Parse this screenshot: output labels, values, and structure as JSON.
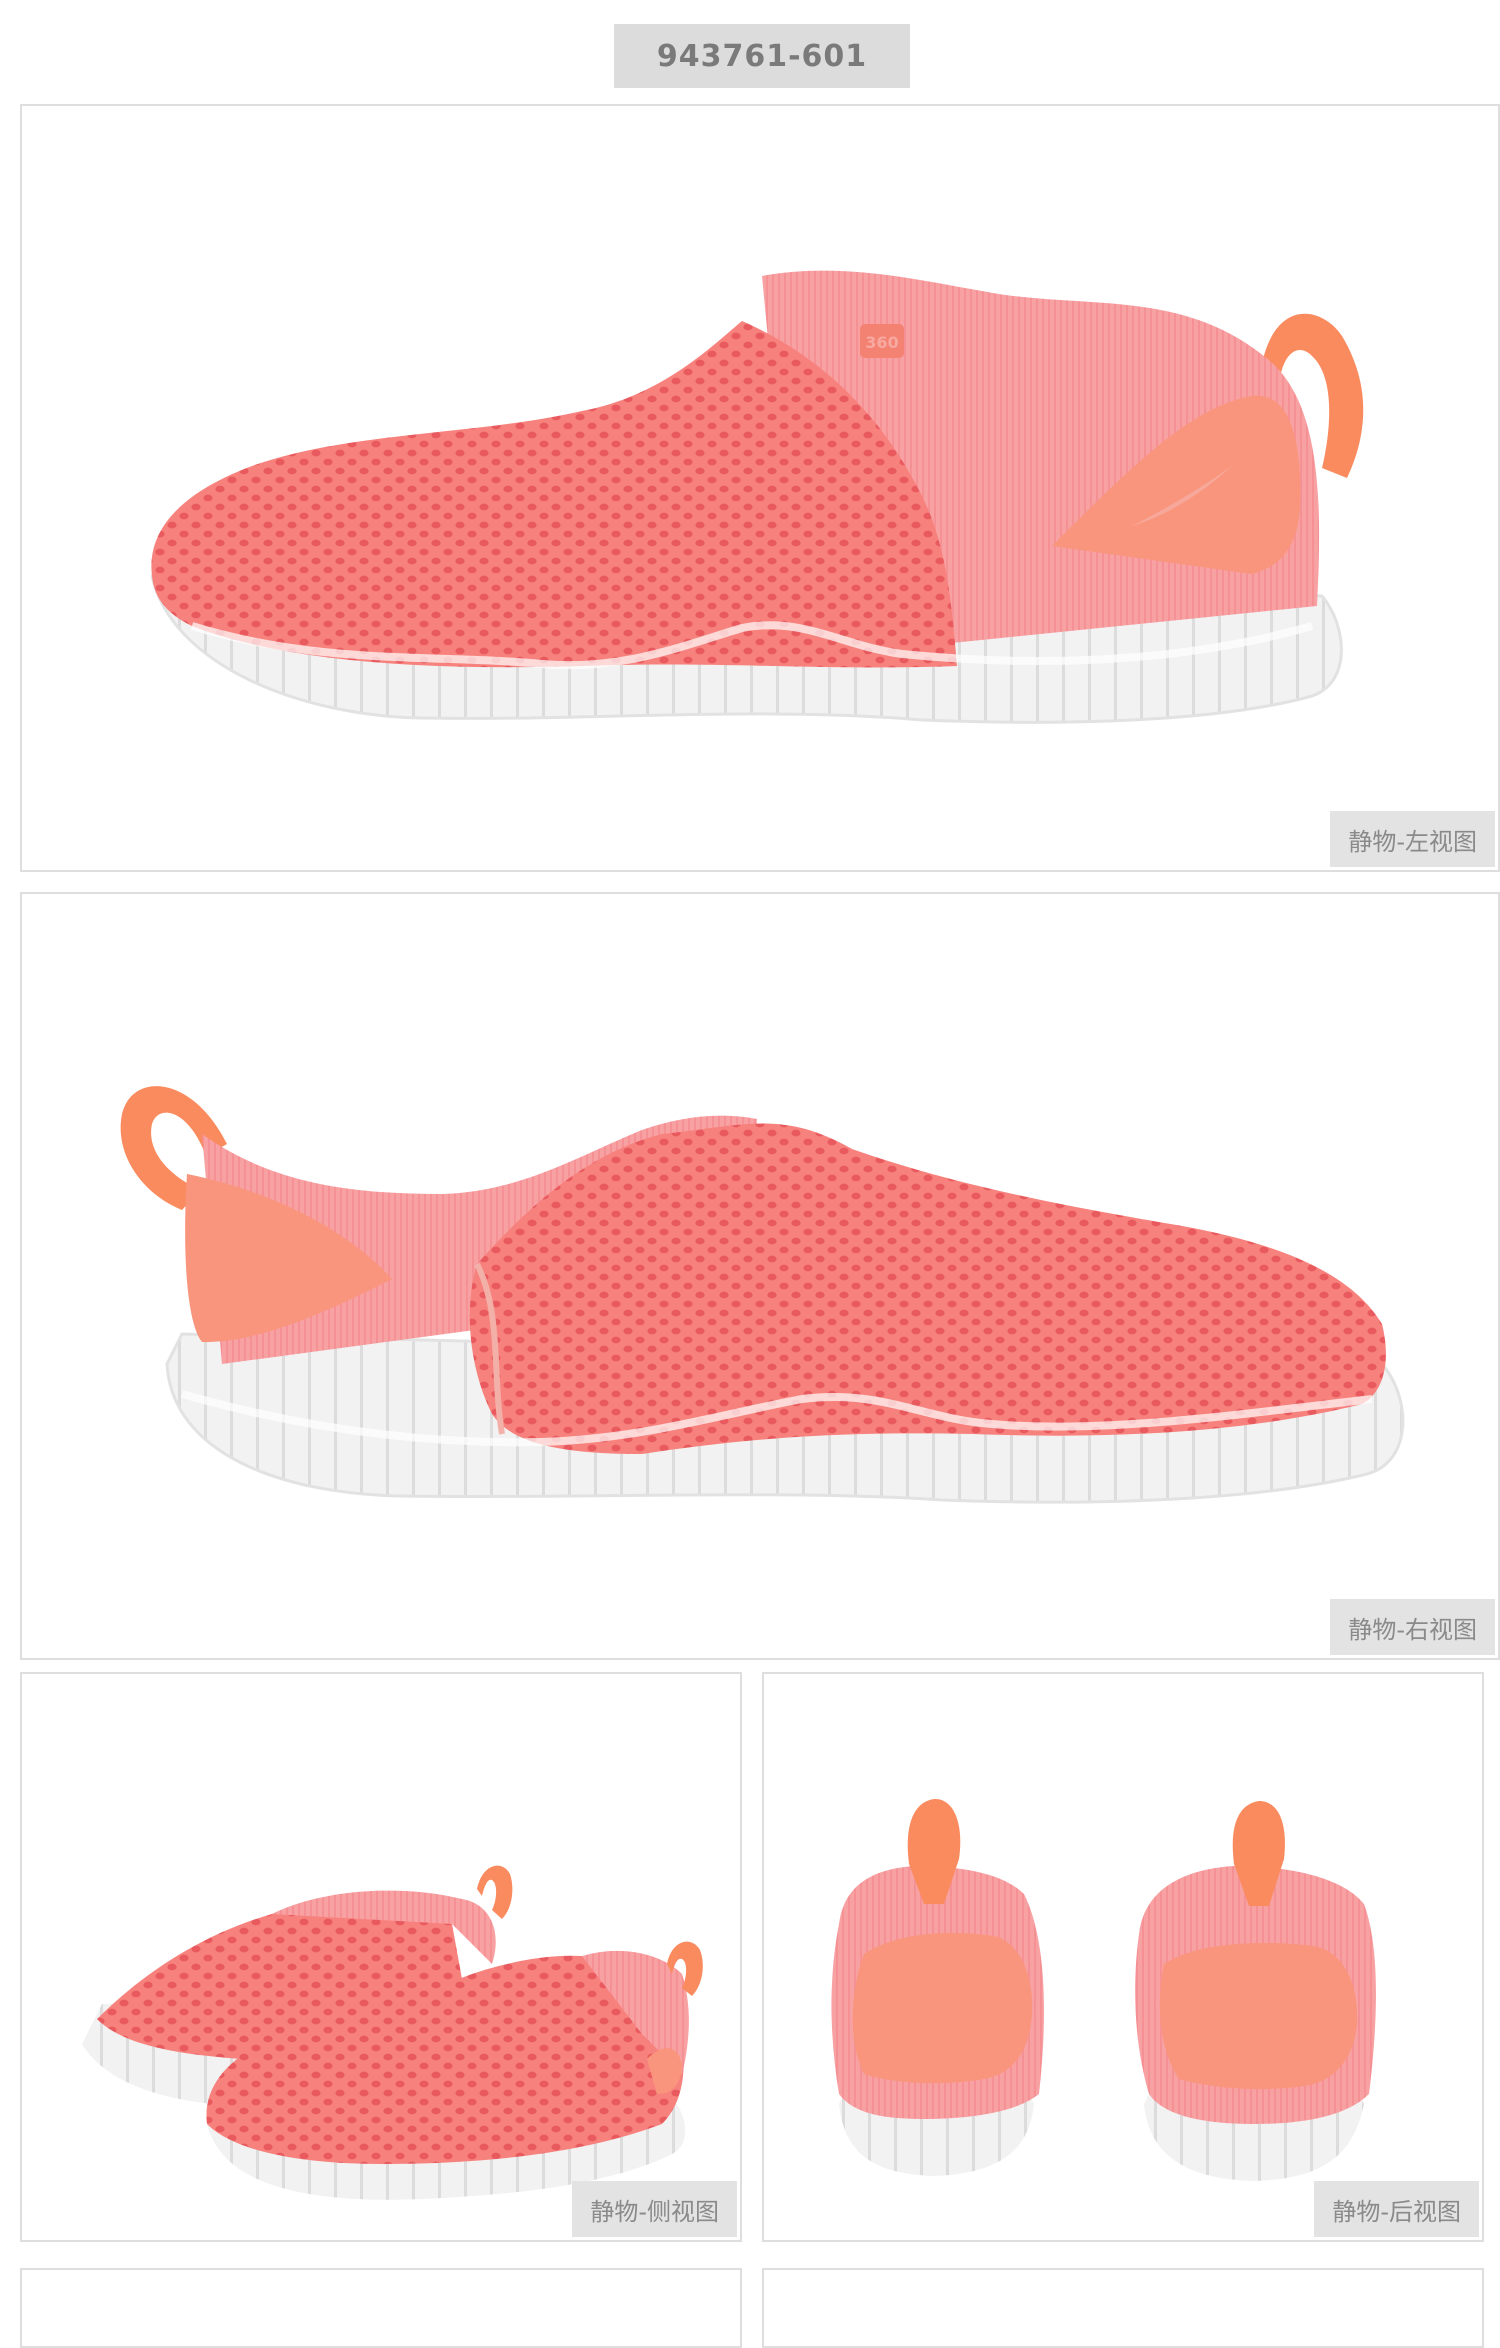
{
  "header": {
    "sku": "943761-601"
  },
  "colors": {
    "mesh": "#f47d7b",
    "knit": "#f7a0a2",
    "suede": "#f9957c",
    "pull_tab": "#f98b5f",
    "sole": "#eeeeee",
    "caption_bg": "#e3e3e3",
    "sku_bg": "#dcdcdc"
  },
  "gallery": {
    "left_view": {
      "caption": "静物-左视图",
      "tongue_text": "360"
    },
    "right_view": {
      "caption": "静物-右视图"
    },
    "side_view": {
      "caption": "静物-侧视图"
    },
    "back_view": {
      "caption": "静物-后视图"
    }
  }
}
